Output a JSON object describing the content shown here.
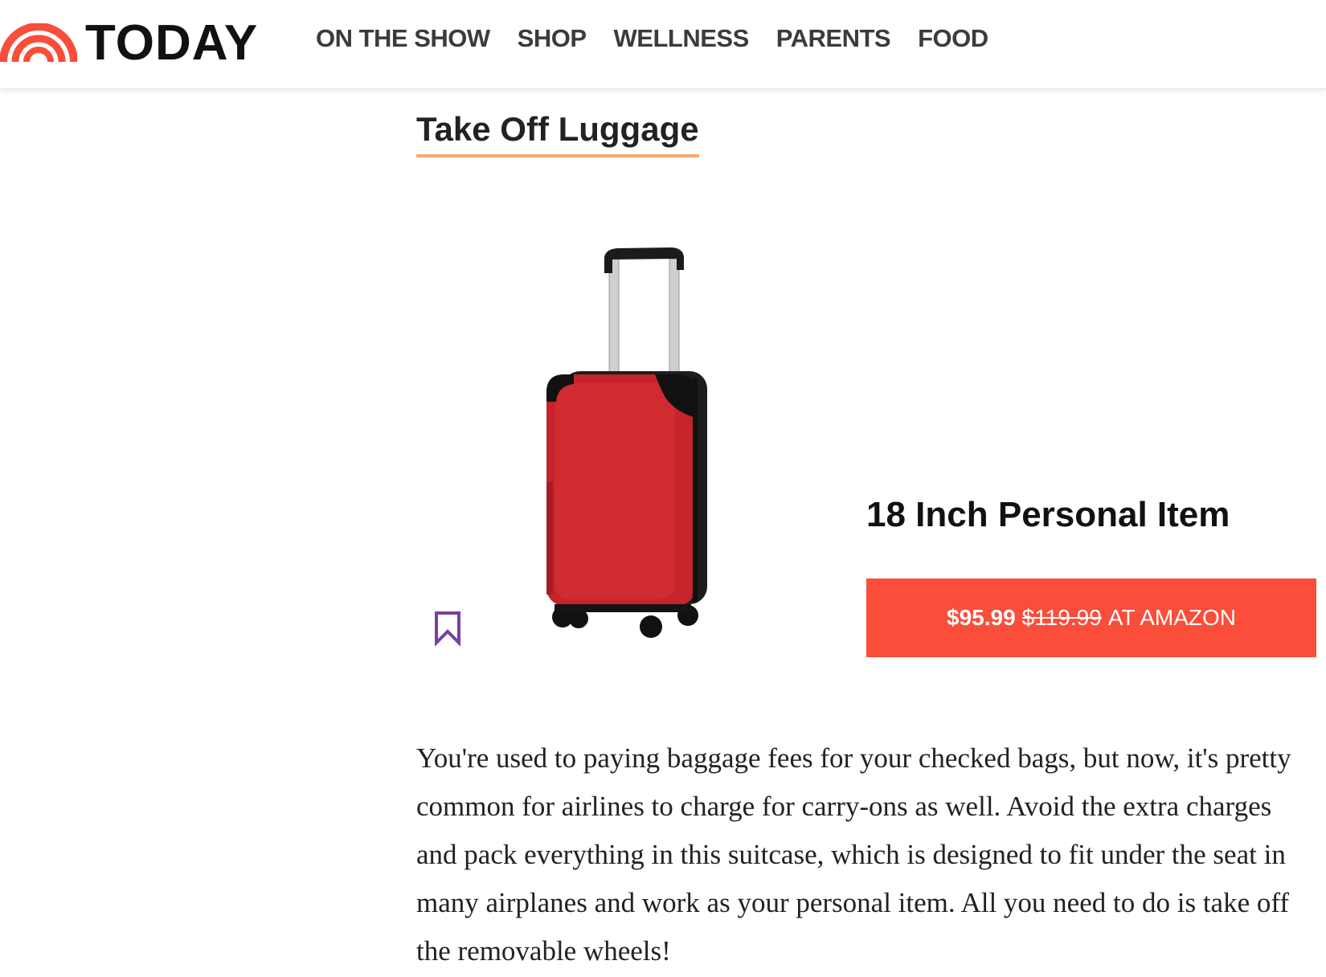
{
  "header": {
    "logo_text": "TODAY",
    "logo_color": "#fa4d3a",
    "nav": [
      "ON THE SHOW",
      "SHOP",
      "WELLNESS",
      "PARENTS",
      "FOOD"
    ]
  },
  "section": {
    "title": "Take Off Luggage",
    "underline_color": "#f6a96e"
  },
  "product": {
    "image_icon": "red-suitcase-image",
    "bookmark_icon": "bookmark-icon",
    "name": "18 Inch Personal Item",
    "price_current": "$95.99",
    "price_original": "$119.99",
    "retailer_label": "AT AMAZON",
    "button_color": "#fa4d3a"
  },
  "article": {
    "text": "You're used to paying baggage fees for your checked bags, but now, it's pretty common for airlines to charge for carry-ons as well. Avoid the extra charges and pack everything in this suitcase, which is designed to fit under the seat in many airplanes and work as your personal item. All you need to do is take off the removable wheels!"
  }
}
